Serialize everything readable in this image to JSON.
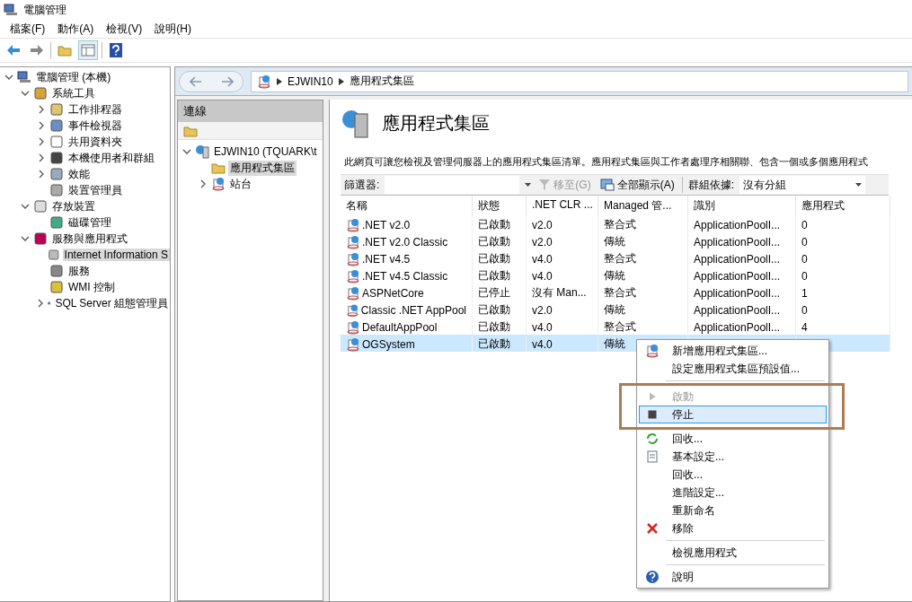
{
  "window": {
    "title": "電腦管理"
  },
  "menu": [
    "檔案(F)",
    "動作(A)",
    "檢視(V)",
    "說明(H)"
  ],
  "tree": [
    {
      "label": "電腦管理 (本機)",
      "expanded": true,
      "selected": false,
      "children": [
        {
          "label": "系統工具",
          "expanded": true,
          "selected": false,
          "children": [
            {
              "label": "工作排程器",
              "expanded": false,
              "selected": false
            },
            {
              "label": "事件檢視器",
              "expanded": false,
              "selected": false
            },
            {
              "label": "共用資料夾",
              "expanded": false,
              "selected": false
            },
            {
              "label": "本機使用者和群組",
              "expanded": false,
              "selected": false
            },
            {
              "label": "效能",
              "expanded": false,
              "selected": false
            },
            {
              "label": "裝置管理員",
              "selected": false
            }
          ]
        },
        {
          "label": "存放裝置",
          "expanded": true,
          "selected": false,
          "children": [
            {
              "label": "磁碟管理",
              "selected": false
            }
          ]
        },
        {
          "label": "服務與應用程式",
          "expanded": true,
          "selected": false,
          "children": [
            {
              "label": "Internet Information S",
              "selected": true
            },
            {
              "label": "服務",
              "selected": false
            },
            {
              "label": "WMI 控制",
              "selected": false
            },
            {
              "label": "SQL Server 組態管理員",
              "expanded": false,
              "selected": false
            }
          ]
        }
      ]
    }
  ],
  "breadcrumb": [
    "EJWIN10",
    "應用程式集區"
  ],
  "connections": {
    "title": "連線",
    "tree": [
      {
        "label": "EJWIN10 (TQUARK\\t",
        "expanded": true,
        "selected": false,
        "children": [
          {
            "label": "應用程式集區",
            "selected": true
          },
          {
            "label": "站台",
            "expanded": false,
            "selected": false
          }
        ]
      }
    ]
  },
  "content": {
    "title": "應用程式集區",
    "description": "此網頁可讓您檢視及管理伺服器上的應用程式集區清單。應用程式集區與工作者處理序相關聯、包含一個或多個應用程式",
    "filter": {
      "label": "篩選器:",
      "go": "移至(G)",
      "go_disabled": true,
      "show_all": "全部顯示(A)",
      "group_label": "群組依據:",
      "group_value": "沒有分組"
    },
    "table": {
      "columns": [
        "名稱",
        "狀態",
        ".NET CLR ...",
        "Managed 管...",
        "識別",
        "應用程式"
      ],
      "rows": [
        {
          "cells": [
            ".NET v2.0",
            "已啟動",
            "v2.0",
            "整合式",
            "ApplicationPoolI...",
            "0"
          ],
          "selected": false
        },
        {
          "cells": [
            ".NET v2.0 Classic",
            "已啟動",
            "v2.0",
            "傳統",
            "ApplicationPoolI...",
            "0"
          ],
          "selected": false
        },
        {
          "cells": [
            ".NET v4.5",
            "已啟動",
            "v4.0",
            "整合式",
            "ApplicationPoolI...",
            "0"
          ],
          "selected": false
        },
        {
          "cells": [
            ".NET v4.5 Classic",
            "已啟動",
            "v4.0",
            "傳統",
            "ApplicationPoolI...",
            "0"
          ],
          "selected": false
        },
        {
          "cells": [
            "ASPNetCore",
            "已停止",
            "沒有 Man...",
            "整合式",
            "ApplicationPoolI...",
            "1"
          ],
          "selected": false
        },
        {
          "cells": [
            "Classic .NET AppPool",
            "已啟動",
            "v2.0",
            "傳統",
            "ApplicationPoolI...",
            "0"
          ],
          "selected": false
        },
        {
          "cells": [
            "DefaultAppPool",
            "已啟動",
            "v4.0",
            "整合式",
            "ApplicationPoolI...",
            "4"
          ],
          "selected": false
        },
        {
          "cells": [
            "OGSystem",
            "已啟動",
            "v4.0",
            "傳統"
          ],
          "selected": true
        }
      ]
    }
  },
  "context_menu": [
    {
      "kind": "item",
      "label": "新增應用程式集區...",
      "disabled": false,
      "selected": false
    },
    {
      "kind": "item",
      "label": "設定應用程式集區預設值...",
      "disabled": false,
      "selected": false
    },
    {
      "kind": "separator"
    },
    {
      "kind": "item",
      "label": "啟動",
      "disabled": true,
      "selected": false,
      "highlighted": true
    },
    {
      "kind": "item",
      "label": "停止",
      "disabled": false,
      "selected": true,
      "highlighted": true
    },
    {
      "kind": "item",
      "label": "回收...",
      "disabled": false,
      "selected": false
    },
    {
      "kind": "item",
      "label": "基本設定...",
      "disabled": false,
      "selected": false
    },
    {
      "kind": "item",
      "label": "回收...",
      "disabled": false,
      "selected": false
    },
    {
      "kind": "item",
      "label": "進階設定...",
      "disabled": false,
      "selected": false
    },
    {
      "kind": "item",
      "label": "重新命名",
      "disabled": false,
      "selected": false
    },
    {
      "kind": "item",
      "label": "移除",
      "disabled": false,
      "selected": false
    },
    {
      "kind": "separator"
    },
    {
      "kind": "item",
      "label": "檢視應用程式",
      "disabled": false,
      "selected": false
    },
    {
      "kind": "separator"
    },
    {
      "kind": "item",
      "label": "說明",
      "disabled": false,
      "selected": false
    }
  ]
}
